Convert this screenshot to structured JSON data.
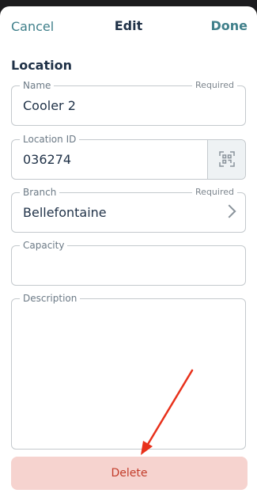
{
  "nav": {
    "cancel_label": "Cancel",
    "title": "Edit",
    "done_label": "Done"
  },
  "section": {
    "title": "Location"
  },
  "fields": {
    "name": {
      "label": "Name",
      "required": "Required",
      "value": "Cooler 2"
    },
    "location_id": {
      "label": "Location ID",
      "value": "036274",
      "scan_icon": "qr-scan-icon"
    },
    "branch": {
      "label": "Branch",
      "required": "Required",
      "value": "Bellefontaine",
      "chevron_icon": "chevron-right-icon"
    },
    "capacity": {
      "label": "Capacity",
      "value": ""
    },
    "description": {
      "label": "Description",
      "value": ""
    }
  },
  "delete_label": "Delete",
  "colors": {
    "accent": "#3f7f8a",
    "title": "#1f3147",
    "delete_bg": "#f6d3cf",
    "delete_text": "#c23c2a",
    "annotation_arrow": "#e8311b"
  }
}
